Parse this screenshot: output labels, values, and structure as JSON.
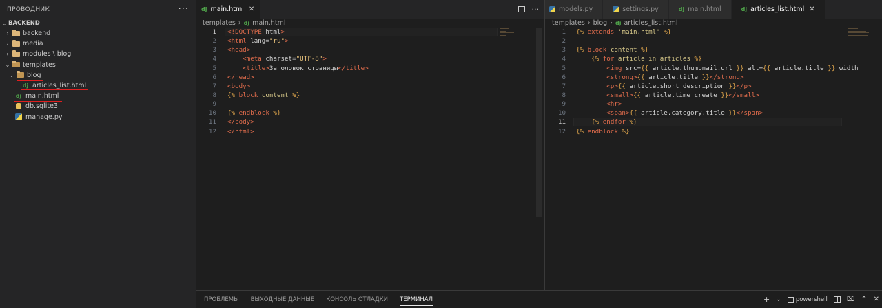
{
  "sidebar": {
    "title": "ПРОВОДНИК",
    "section": "BACKEND",
    "items": [
      {
        "label": "backend",
        "type": "folder",
        "chevron": "›"
      },
      {
        "label": "media",
        "type": "folder",
        "chevron": "›"
      },
      {
        "label": "modules \\ blog",
        "type": "folder",
        "chevron": "›"
      },
      {
        "label": "templates",
        "type": "folder-open",
        "chevron": "⌄"
      },
      {
        "label": "blog",
        "type": "folder-open",
        "chevron": "⌄"
      },
      {
        "label": "articles_list.html",
        "type": "django"
      },
      {
        "label": "main.html",
        "type": "django"
      },
      {
        "label": "db.sqlite3",
        "type": "db"
      },
      {
        "label": "manage.py",
        "type": "python"
      }
    ]
  },
  "left_editor": {
    "tab_label": "main.html",
    "tab_icon": "dj",
    "breadcrumb": [
      "templates",
      "main.html"
    ],
    "current_line": 1,
    "lines": [
      "<!DOCTYPE html>",
      "<html lang=\"ru\">",
      "<head>",
      "    <meta charset=\"UTF-8\">",
      "    <title>Заголовок страницы</title>",
      "</head>",
      "<body>",
      "{% block content %}",
      "",
      "{% endblock %}",
      "</body>",
      "</html>"
    ]
  },
  "right_editor": {
    "tabs": [
      {
        "label": "models.py",
        "icon": "python"
      },
      {
        "label": "settings.py",
        "icon": "python"
      },
      {
        "label": "main.html",
        "icon": "dj"
      },
      {
        "label": "articles_list.html",
        "icon": "dj",
        "active": true
      }
    ],
    "breadcrumb": [
      "templates",
      "blog",
      "articles_list.html"
    ],
    "current_line": 11,
    "lines": [
      "{% extends 'main.html' %}",
      "",
      "{% block content %}",
      "    {% for article in articles %}",
      "        <img src={{ article.thumbnail.url }} alt={{ article.title }} width",
      "        <strong>{{ article.title }}</strong>",
      "        <p>{{ article.short_description }}</p>",
      "        <small>{{ article.time_create }}</small>",
      "        <hr>",
      "        <span>{{ article.category.title }}</span>",
      "    {% endfor %}",
      "{% endblock %}"
    ]
  },
  "panel": {
    "tabs": [
      "ПРОБЛЕМЫ",
      "ВЫХОДНЫЕ ДАННЫЕ",
      "КОНСОЛЬ ОТЛАДКИ",
      "ТЕРМИНАЛ"
    ],
    "active_tab": "ТЕРМИНАЛ",
    "terminal_label": "powershell"
  },
  "icons": {
    "more": "···",
    "close": "✕",
    "add": "+",
    "chevron_down": "⌄",
    "trash": "🗑",
    "maximize": "^",
    "split": "split-editor-icon"
  },
  "colors": {
    "django": "#4fa34a",
    "folder": "#dcb67a",
    "underline_annotation": "#e01f1f"
  }
}
